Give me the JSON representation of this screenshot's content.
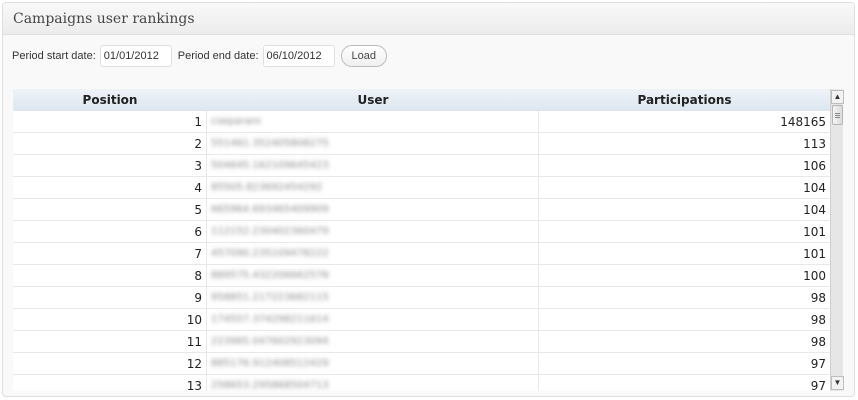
{
  "header": {
    "title": "Campaigns user rankings"
  },
  "filters": {
    "start_label": "Period start date:",
    "start_value": "01/01/2012",
    "end_label": "Period end date:",
    "end_value": "06/10/2012",
    "load_label": "Load"
  },
  "table": {
    "columns": [
      "Position",
      "User",
      "Participations"
    ],
    "rows": [
      {
        "position": "1",
        "user": "ciaipararo",
        "participations": "148165"
      },
      {
        "position": "2",
        "user": "551461.352405808275",
        "participations": "113"
      },
      {
        "position": "3",
        "user": "504645.162109645423",
        "participations": "106"
      },
      {
        "position": "4",
        "user": "85505.823692454292",
        "participations": "104"
      },
      {
        "position": "5",
        "user": "665964.693465409909",
        "participations": "104"
      },
      {
        "position": "6",
        "user": "112152.230402360479",
        "participations": "101"
      },
      {
        "position": "7",
        "user": "457090.235109478222",
        "participations": "101"
      },
      {
        "position": "8",
        "user": "889575.432206662578",
        "participations": "100"
      },
      {
        "position": "9",
        "user": "958851.217223682115",
        "participations": "98"
      },
      {
        "position": "10",
        "user": "174557.374298211614",
        "participations": "98"
      },
      {
        "position": "11",
        "user": "223965.047602923094",
        "participations": "98"
      },
      {
        "position": "12",
        "user": "885176.912408512429",
        "participations": "97"
      },
      {
        "position": "13",
        "user": "258653.295868504713",
        "participations": "97"
      }
    ]
  },
  "icons": {
    "scroll_up": "up-arrow-icon",
    "scroll_down": "down-arrow-icon"
  }
}
